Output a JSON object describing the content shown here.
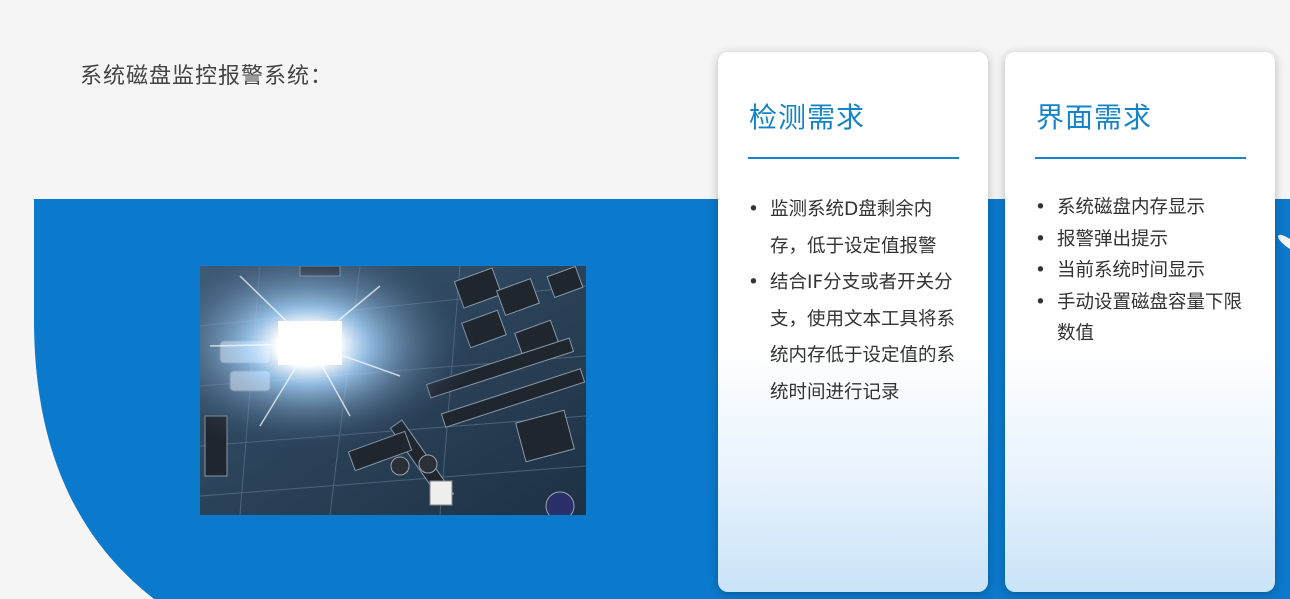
{
  "page": {
    "title": "系统磁盘监控报警系统："
  },
  "colors": {
    "accent": "#0b79cc",
    "heading": "#1484c8"
  },
  "image": {
    "subject": "circuit-board-chip-photo"
  },
  "cards": [
    {
      "title": "检测需求",
      "items": [
        {
          "text": "监测系统D盘剩余内存，低于设定值报警"
        },
        {
          "text": "结合IF分支或者开关分支，使用文本工具将系统内存低于设定值的系统时间进行记录"
        }
      ]
    },
    {
      "title": "界面需求",
      "items": [
        {
          "text": "系统磁盘内存显示"
        },
        {
          "text": "报警弹出提示"
        },
        {
          "text": "当前系统时间显示"
        },
        {
          "text": "手动设置磁盘容量下限数值"
        }
      ]
    }
  ],
  "bullet_char": "•"
}
